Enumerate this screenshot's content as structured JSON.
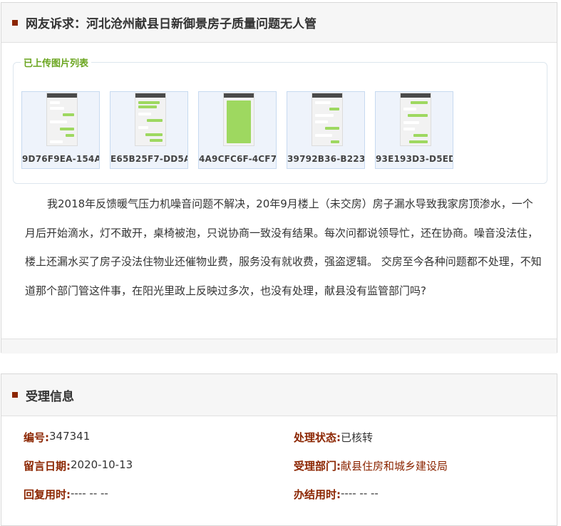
{
  "complaint": {
    "title": "网友诉求：河北沧州献县日新御景房子质量问题无人管",
    "uploads_legend": "已上传图片列表",
    "images": [
      {
        "label": "9D76F9EA-154A"
      },
      {
        "label": "E65B25F7-DD5A"
      },
      {
        "label": "4A9CFC6F-4CF7-"
      },
      {
        "label": "39792B36-B223-"
      },
      {
        "label": "93E193D3-D5ED"
      }
    ],
    "body": "我2018年反馈暖气压力机噪音问题不解决，20年9月楼上（未交房）房子漏水导致我家房顶渗水，一个月后开始滴水，灯不敢开，桌椅被泡，只说协商一致没有结果。每次问都说领导忙，还在协商。噪音没法住，楼上还漏水买了房子没法住物业还催物业费，服务没有就收费，强盗逻辑。 交房至今各种问题都不处理，不知道那个部门管这件事，在阳光里政上反映过多次，也没有处理，献县没有监管部门吗?"
  },
  "acceptance": {
    "title": "受理信息",
    "number_label": "编号:",
    "number_value": "347341",
    "status_label": "处理状态:",
    "status_value": "已核转",
    "date_label": "留言日期:",
    "date_value": "2020-10-13",
    "dept_label": "受理部门:",
    "dept_value": "献县住房和城乡建设局",
    "reply_label": "回复用时:",
    "reply_value": "---- -- --",
    "done_label": "办结用时:",
    "done_value": "---- -- --"
  }
}
